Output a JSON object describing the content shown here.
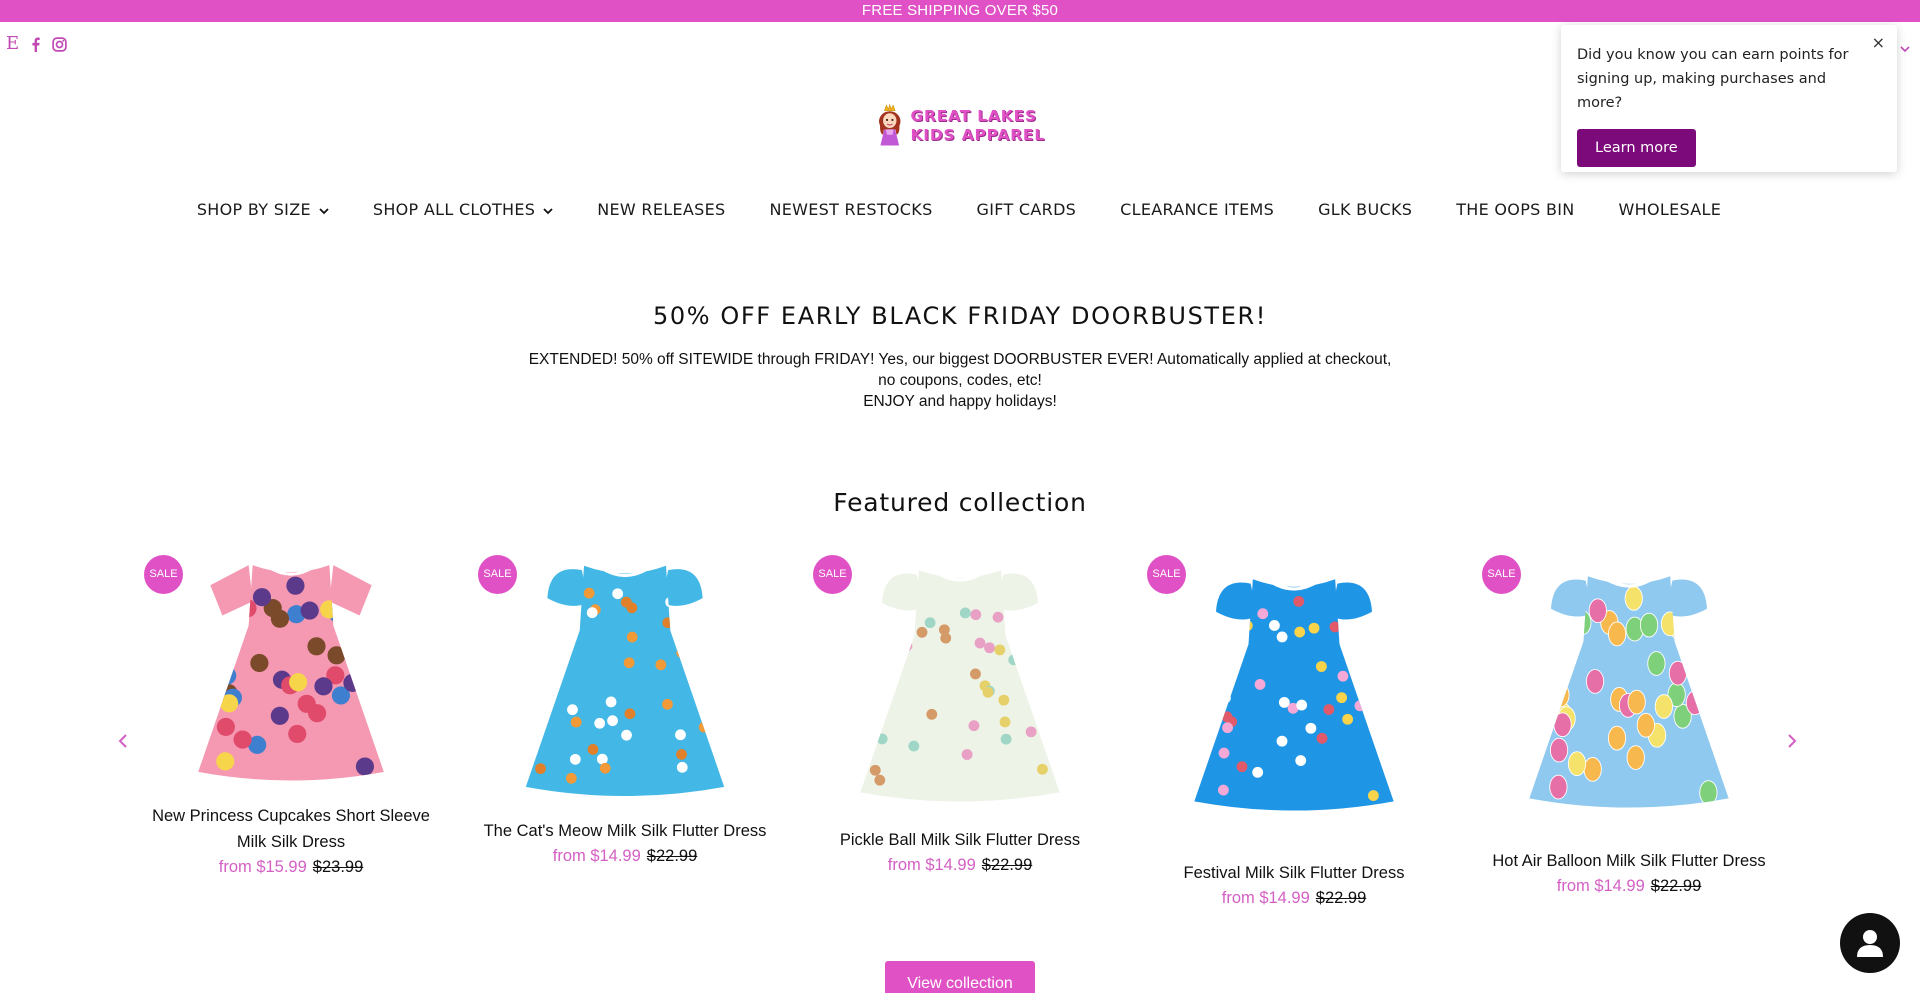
{
  "announcement": "FREE SHIPPING OVER $50",
  "social": {
    "etsy_glyph": "E",
    "icons": [
      "etsy-icon",
      "facebook-icon",
      "instagram-icon"
    ]
  },
  "brand": {
    "logo_line1": "GREAT LAKES",
    "logo_line2": "KIDS APPAREL",
    "accent_color": "#e051c6",
    "dark_accent_color": "#7d0a7a"
  },
  "nav": {
    "items": [
      {
        "label": "SHOP BY SIZE",
        "dropdown": true
      },
      {
        "label": "SHOP ALL CLOTHES",
        "dropdown": true
      },
      {
        "label": "NEW RELEASES",
        "dropdown": false
      },
      {
        "label": "NEWEST RESTOCKS",
        "dropdown": false
      },
      {
        "label": "GIFT CARDS",
        "dropdown": false
      },
      {
        "label": "CLEARANCE ITEMS",
        "dropdown": false
      },
      {
        "label": "GLK BUCKS",
        "dropdown": false
      },
      {
        "label": "THE OOPS BIN",
        "dropdown": false
      },
      {
        "label": "WHOLESALE",
        "dropdown": false
      }
    ]
  },
  "popup": {
    "text": "Did you know you can earn points for signing up, making purchases and more?",
    "button": "Learn more",
    "close": "×"
  },
  "promo": {
    "title": "50% OFF EARLY BLACK FRIDAY DOORBUSTER!",
    "line1": "EXTENDED! 50% off SITEWIDE through FRIDAY! Yes, our biggest DOORBUSTER EVER! Automatically applied at checkout,",
    "line2": "no coupons, codes, etc!",
    "line3": "ENJOY and happy holidays!"
  },
  "featured": {
    "title": "Featured collection",
    "view_button": "View collection",
    "products": [
      {
        "badge": "SALE",
        "title": "New Princess Cupcakes Short Sleeve Milk Silk Dress",
        "price": "from $15.99",
        "compare": "$23.99",
        "pattern": "cupcakes",
        "bg": "#f598b2"
      },
      {
        "badge": "SALE",
        "title": "The Cat's Meow Milk Silk Flutter Dress",
        "price": "from $14.99",
        "compare": "$22.99",
        "pattern": "cats",
        "bg": "#43b7e6"
      },
      {
        "badge": "SALE",
        "title": "Pickle Ball Milk Silk Flutter Dress",
        "price": "from $14.99",
        "compare": "$22.99",
        "pattern": "pickleball",
        "bg": "#eef3e8"
      },
      {
        "badge": "SALE",
        "title": "Festival Milk Silk Flutter Dress",
        "price": "from $14.99",
        "compare": "$22.99",
        "pattern": "festival",
        "bg": "#1f95e6"
      },
      {
        "badge": "SALE",
        "title": "Hot Air Balloon Milk Silk Flutter Dress",
        "price": "from $14.99",
        "compare": "$22.99",
        "pattern": "balloons",
        "bg": "#8fc9ef"
      }
    ]
  }
}
